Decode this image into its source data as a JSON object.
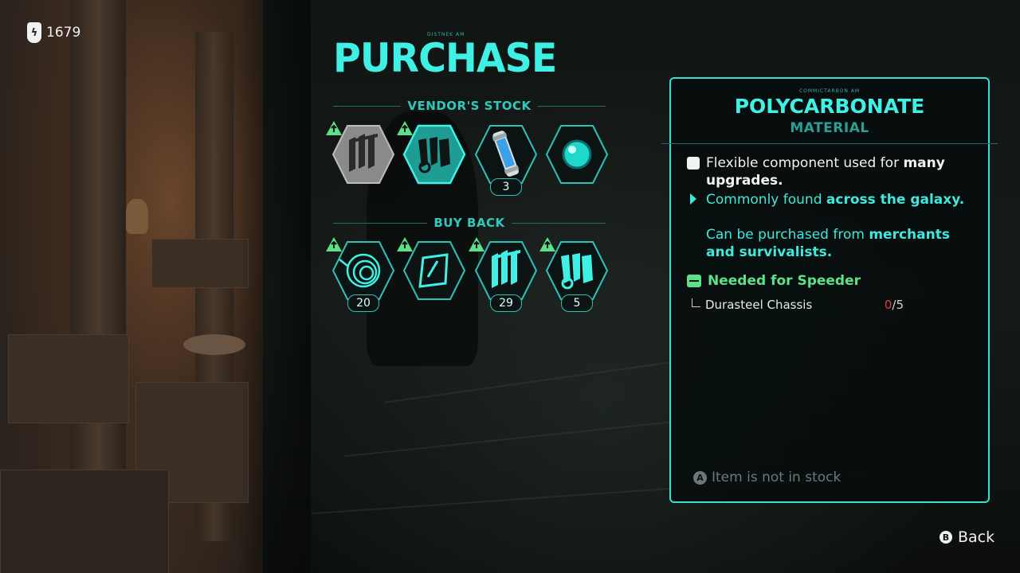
{
  "currency": {
    "icon": "currency-token-icon",
    "value": "1679"
  },
  "purchase": {
    "title": "PURCHASE",
    "micro_label": "DISTNEK AM",
    "vendor_stock": {
      "heading": "VENDOR'S STOCK",
      "items": [
        {
          "icon": "metal-plates-icon",
          "count": null,
          "selected": false,
          "upgrade": true
        },
        {
          "icon": "polycarbonate-icon",
          "count": null,
          "selected": true,
          "upgrade": true
        },
        {
          "icon": "canister-icon",
          "count": "3",
          "selected": false,
          "upgrade": false
        },
        {
          "icon": "orb-icon",
          "count": null,
          "selected": false,
          "upgrade": false
        }
      ]
    },
    "buy_back": {
      "heading": "BUY BACK",
      "items": [
        {
          "icon": "cable-coil-icon",
          "count": "20",
          "upgrade": true
        },
        {
          "icon": "panel-icon",
          "count": "",
          "upgrade": true
        },
        {
          "icon": "metal-plates-icon",
          "count": "29",
          "upgrade": true
        },
        {
          "icon": "polycarbonate-icon",
          "count": "5",
          "upgrade": true
        }
      ]
    }
  },
  "info": {
    "micro_label": "COMMICTARBON AM",
    "title": "POLYCARBONATE",
    "subtitle": "MATERIAL",
    "desc1_a": "Flexible component used for ",
    "desc1_b": "many upgrades.",
    "desc2_a": "Commonly found ",
    "desc2_b": "across the galaxy.",
    "desc3_a": "Can be purchased from ",
    "desc3_b": "merchants and survivalists.",
    "needed_label": "Needed for Speeder",
    "requirement": {
      "name": "Durasteel Chassis",
      "have": "0",
      "need": "/5"
    },
    "stock_status": "Item is not in stock",
    "stock_button": "A"
  },
  "back": {
    "button": "B",
    "label": "Back"
  },
  "colors": {
    "accent": "#40f0e4",
    "needed": "#5ee08a",
    "missing": "#e03a3a"
  }
}
